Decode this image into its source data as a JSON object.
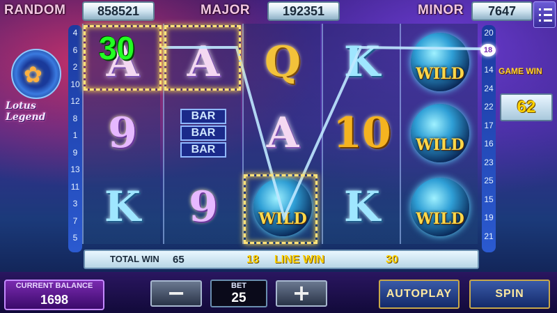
{
  "jackpots": {
    "random_label": "RANDOM",
    "random_value": "858521",
    "major_label": "MAJOR",
    "major_value": "192351",
    "minor_label": "MINOR",
    "minor_value": "7647"
  },
  "logo": {
    "title": "Lotus Legend"
  },
  "game_win": {
    "label": "GAME WIN",
    "value": "62"
  },
  "reels": [
    [
      "A",
      "9",
      "K"
    ],
    [
      "A",
      "BAR",
      "9"
    ],
    [
      "Q",
      "A",
      "WILD"
    ],
    [
      "K",
      "10",
      "K"
    ],
    [
      "WILD",
      "WILD",
      "WILD"
    ]
  ],
  "bar_label": "BAR",
  "wild_label": "WILD",
  "win_amount_overlay": "30",
  "paylines": {
    "left": [
      "4",
      "6",
      "2",
      "10",
      "12",
      "8",
      "1",
      "9",
      "13",
      "11",
      "3",
      "7",
      "5"
    ],
    "right": [
      "20",
      "18",
      "14",
      "24",
      "22",
      "17",
      "16",
      "23",
      "25",
      "15",
      "19",
      "21"
    ],
    "active": "18"
  },
  "win_bar": {
    "total_win_label": "TOTAL WIN",
    "total_win_value": "65",
    "line_number": "18",
    "line_win_label": "LINE WIN",
    "line_win_value": "30"
  },
  "bottom": {
    "balance_label": "CURRENT BALANCE",
    "balance_value": "1698",
    "minus_label": "−",
    "bet_label": "BET",
    "bet_value": "25",
    "plus_label": "+",
    "autoplay_label": "AUTOPLAY",
    "spin_label": "SPIN"
  },
  "colors": {
    "win_green": "#22ff22",
    "gold": "#ffd200",
    "payline": "#bfe8ff"
  },
  "icons": [
    "menu-icon",
    "lotus-icon"
  ]
}
